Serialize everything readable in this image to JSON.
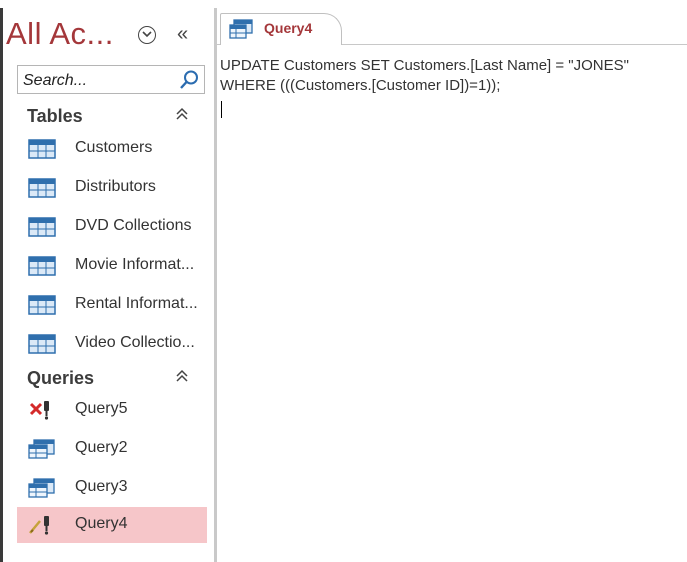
{
  "nav": {
    "title": "All Ac...",
    "collapse_icon": "«",
    "search_placeholder": "Search...",
    "groups": [
      {
        "label": "Tables",
        "toggle": "≈",
        "items": [
          {
            "label": "Customers",
            "icon": "table-icon"
          },
          {
            "label": "Distributors",
            "icon": "table-icon"
          },
          {
            "label": "DVD Collections",
            "icon": "table-icon"
          },
          {
            "label": "Movie Informat...",
            "icon": "table-icon"
          },
          {
            "label": "Rental Informat...",
            "icon": "table-icon"
          },
          {
            "label": "Video Collectio...",
            "icon": "table-icon"
          }
        ]
      },
      {
        "label": "Queries",
        "toggle": "≈",
        "items": [
          {
            "label": "Query5",
            "icon": "delete-query-icon"
          },
          {
            "label": "Query2",
            "icon": "select-query-icon"
          },
          {
            "label": "Query3",
            "icon": "select-query-icon"
          },
          {
            "label": "Query4",
            "icon": "update-query-icon",
            "selected": true
          }
        ]
      }
    ]
  },
  "document": {
    "tab_label": "Query4",
    "tab_icon": "update-query-icon",
    "sql_line1": "UPDATE Customers SET Customers.[Last Name] = \"JONES\"",
    "sql_line2": "WHERE (((Customers.[Customer ID])=1));"
  },
  "colors": {
    "accent": "#a4373a",
    "selected_bg": "#f6c6c9"
  }
}
